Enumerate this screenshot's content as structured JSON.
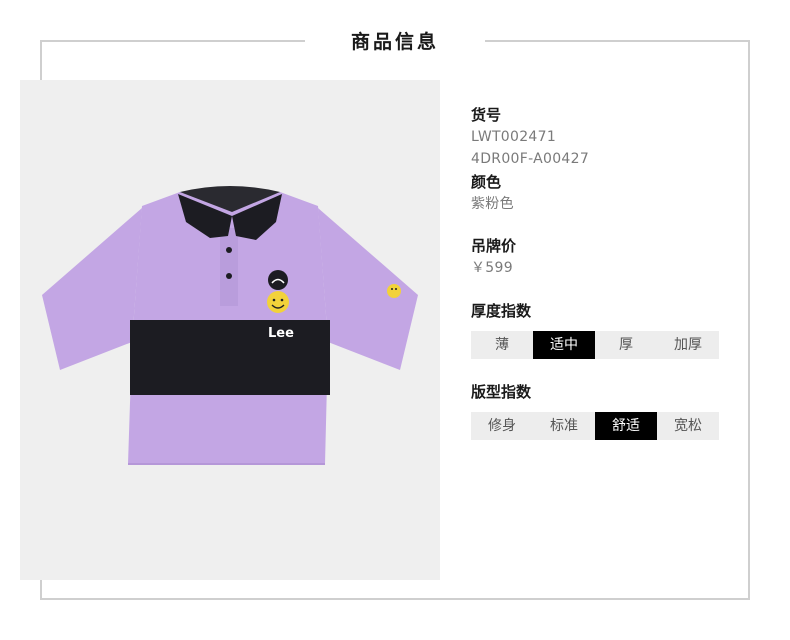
{
  "header": {
    "title": "商品信息"
  },
  "product": {
    "image_alt": "紫粉色 Lee 短袖 POLO 衫",
    "logo_text": "Lee",
    "colors": {
      "shirt": "#c3a6e4",
      "band": "#1c1c22",
      "photo_bg": "#efefef",
      "smiley": "#f2d23a"
    }
  },
  "info": {
    "code_label": "货号",
    "code_value_1": "LWT002471",
    "code_value_2": "4DR00F-A00427",
    "color_label": "颜色",
    "color_value": "紫粉色",
    "price_label": "吊牌价",
    "price_value": "￥599"
  },
  "thickness": {
    "label": "厚度指数",
    "options": [
      "薄",
      "适中",
      "厚",
      "加厚"
    ],
    "selected": "适中"
  },
  "fit": {
    "label": "版型指数",
    "options": [
      "修身",
      "标准",
      "舒适",
      "宽松"
    ],
    "selected": "舒适"
  }
}
